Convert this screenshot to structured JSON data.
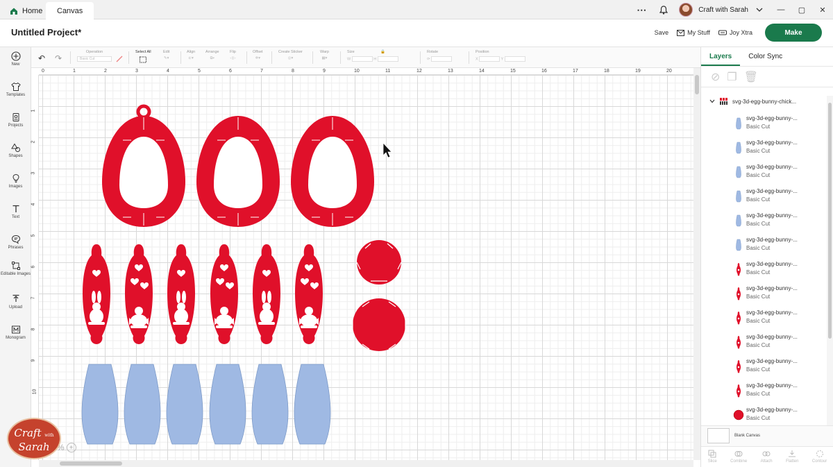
{
  "tabs": {
    "home": "Home",
    "canvas": "Canvas"
  },
  "account": {
    "name": "Craft with Sarah"
  },
  "window": {
    "minimize": "—",
    "restore": "▢",
    "close": "✕"
  },
  "header": {
    "title": "Untitled Project*",
    "save": "Save",
    "my_stuff": "My Stuff",
    "joy_xtra": "Joy Xtra",
    "make": "Make"
  },
  "sidebar": {
    "items": [
      {
        "label": "New",
        "icon": "plus-circle-icon"
      },
      {
        "label": "Templates",
        "icon": "shirt-icon"
      },
      {
        "label": "Projects",
        "icon": "projects-icon"
      },
      {
        "label": "Shapes",
        "icon": "shapes-icon"
      },
      {
        "label": "Images",
        "icon": "lightbulb-icon"
      },
      {
        "label": "Text",
        "icon": "text-icon"
      },
      {
        "label": "Phrases",
        "icon": "speech-bubble-icon"
      },
      {
        "label": "Editable Images",
        "icon": "editable-images-icon"
      },
      {
        "label": "Upload",
        "icon": "upload-icon"
      },
      {
        "label": "Monogram",
        "icon": "monogram-icon"
      }
    ]
  },
  "toolbar": {
    "operation": "Operation",
    "operation_value": "Basic Cut",
    "select_all": "Select All",
    "edit": "Edit",
    "align": "Align",
    "arrange": "Arrange",
    "flip": "Flip",
    "offset": "Offset",
    "create_sticker": "Create Sticker",
    "warp": "Warp",
    "size": "Size",
    "size_w": "W",
    "size_h": "H",
    "rotate": "Rotate",
    "position": "Position",
    "pos_x": "X",
    "pos_y": "Y"
  },
  "ruler": {
    "top": [
      "0",
      "1",
      "2",
      "3",
      "4",
      "5",
      "6",
      "7",
      "8",
      "9",
      "10",
      "11",
      "12",
      "13",
      "14",
      "15",
      "16",
      "17",
      "18",
      "19",
      "20"
    ],
    "left": [
      "1",
      "2",
      "3",
      "4",
      "5",
      "6",
      "7",
      "8",
      "9",
      "10"
    ]
  },
  "zoom": {
    "value": "100%",
    "minus": "−",
    "plus": "+"
  },
  "logo": {
    "line1": "Craft",
    "line2": "with",
    "line3": "Sarah"
  },
  "colors": {
    "red": "#e0102a",
    "blue": "#9fb9e3",
    "green": "#1a7a4c"
  },
  "panel": {
    "tabs": {
      "layers": "Layers",
      "color_sync": "Color Sync"
    },
    "group_name": "svg-3d-egg-bunny-chick...",
    "layers": [
      {
        "name": "svg-3d-egg-bunny-...",
        "op": "Basic Cut",
        "kind": "blue"
      },
      {
        "name": "svg-3d-egg-bunny-...",
        "op": "Basic Cut",
        "kind": "blue"
      },
      {
        "name": "svg-3d-egg-bunny-...",
        "op": "Basic Cut",
        "kind": "blue"
      },
      {
        "name": "svg-3d-egg-bunny-...",
        "op": "Basic Cut",
        "kind": "blue"
      },
      {
        "name": "svg-3d-egg-bunny-...",
        "op": "Basic Cut",
        "kind": "blue"
      },
      {
        "name": "svg-3d-egg-bunny-...",
        "op": "Basic Cut",
        "kind": "blue"
      },
      {
        "name": "svg-3d-egg-bunny-...",
        "op": "Basic Cut",
        "kind": "red"
      },
      {
        "name": "svg-3d-egg-bunny-...",
        "op": "Basic Cut",
        "kind": "red"
      },
      {
        "name": "svg-3d-egg-bunny-...",
        "op": "Basic Cut",
        "kind": "red"
      },
      {
        "name": "svg-3d-egg-bunny-...",
        "op": "Basic Cut",
        "kind": "red"
      },
      {
        "name": "svg-3d-egg-bunny-...",
        "op": "Basic Cut",
        "kind": "red"
      },
      {
        "name": "svg-3d-egg-bunny-...",
        "op": "Basic Cut",
        "kind": "red"
      },
      {
        "name": "svg-3d-egg-bunny-...",
        "op": "Basic Cut",
        "kind": "circle"
      }
    ],
    "blank_canvas": "Blank Canvas",
    "bottom": [
      "Slice",
      "Combine",
      "Attach",
      "Flatten",
      "Contour"
    ]
  }
}
